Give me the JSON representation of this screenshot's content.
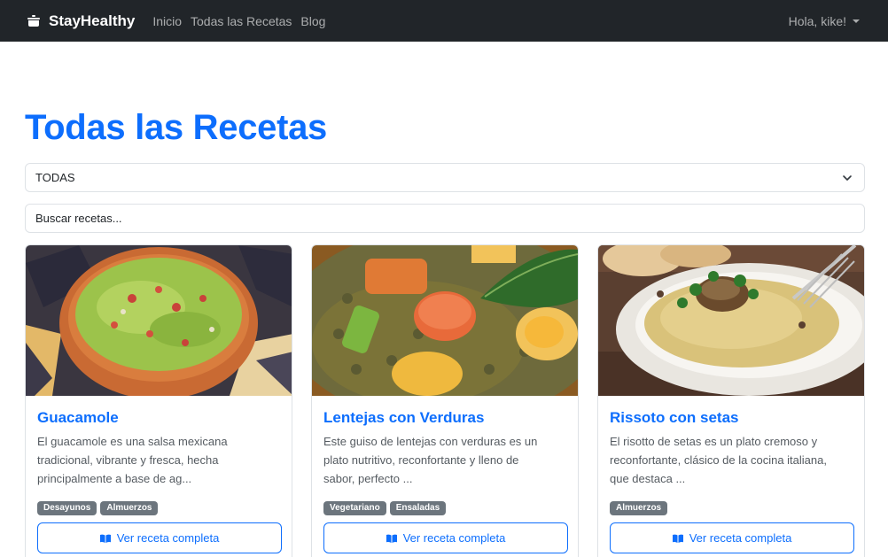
{
  "navbar": {
    "brand": "StayHealthy",
    "links": [
      "Inicio",
      "Todas las Recetas",
      "Blog"
    ],
    "user_greeting": "Hola, kike!"
  },
  "page": {
    "title": "Todas las Recetas",
    "category_select_value": "TODAS",
    "search_placeholder": "Buscar recetas..."
  },
  "recipes": [
    {
      "title": "Guacamole",
      "description": "El guacamole es una salsa mexicana tradicional, vibrante y fresca, hecha principalmente a base de ag...",
      "tags": [
        "Desayunos",
        "Almuerzos"
      ],
      "button_label": "Ver receta completa"
    },
    {
      "title": "Lentejas con Verduras",
      "description": "Este guiso de lentejas con verduras es un plato nutritivo, reconfortante y lleno de sabor, perfecto ...",
      "tags": [
        "Vegetariano",
        "Ensaladas"
      ],
      "button_label": "Ver receta completa"
    },
    {
      "title": "Rissoto con setas",
      "description": "El risotto de setas es un plato cremoso y reconfortante, clásico de la cocina italiana, que destaca ...",
      "tags": [
        "Almuerzos"
      ],
      "button_label": "Ver receta completa"
    }
  ],
  "colors": {
    "navbar_bg": "#212529",
    "primary": "#0d6efd",
    "tag_bg": "#6c757d"
  },
  "icons": {
    "brand": "cooking-pot-icon",
    "select": "chevron-down-icon",
    "button": "book-open-icon"
  }
}
